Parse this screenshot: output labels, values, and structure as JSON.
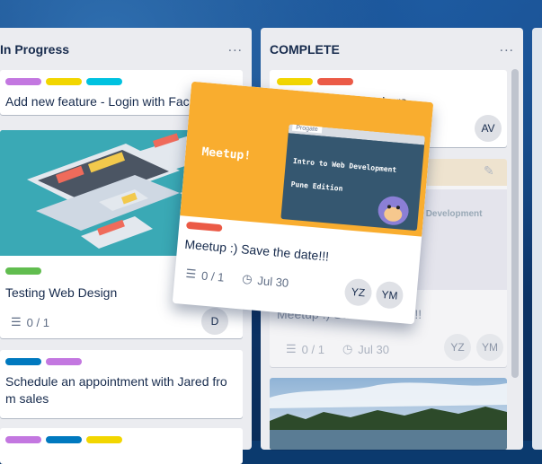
{
  "lists": {
    "in_progress": {
      "title": "In Progress",
      "menu": "...",
      "cards": [
        {
          "title": "Add new feature - Login with Fac",
          "labels": [
            "#c377e0",
            "#f2d600",
            "#00c2e0"
          ]
        },
        {
          "title": "Testing Web Design",
          "labels": [
            "#61bd4f"
          ],
          "checklist": "0 / 1",
          "avatar": "D"
        },
        {
          "title": "Schedule an appointment with Jared from sales",
          "labels": [
            "#0079bf",
            "#c377e0"
          ]
        },
        {
          "labels": [
            "#c377e0",
            "#0079bf",
            "#f2d600"
          ]
        }
      ]
    },
    "complete": {
      "title": "COMPLETE",
      "menu": "...",
      "cards": [
        {
          "title": "Inviting Team members",
          "labels": [
            "#f2d600",
            "#eb5a46"
          ],
          "avatar": "AV"
        },
        {
          "title": "Meetup :) Save the date!!!",
          "checklist": "0 / 1",
          "due": "Jul 30",
          "avatars": [
            "YZ",
            "YM"
          ],
          "cover_text": "Web Development"
        }
      ]
    }
  },
  "dragging_card": {
    "title": "Meetup :) Save the date!!!",
    "label": "#eb5a46",
    "checklist": "0 / 1",
    "due": "Jul 30",
    "avatars": [
      "YZ",
      "YM"
    ],
    "cover": {
      "heading": "Meetup!",
      "tab": "Progate",
      "line1": "Intro to Web Development",
      "line2": "Pune Edition"
    }
  }
}
